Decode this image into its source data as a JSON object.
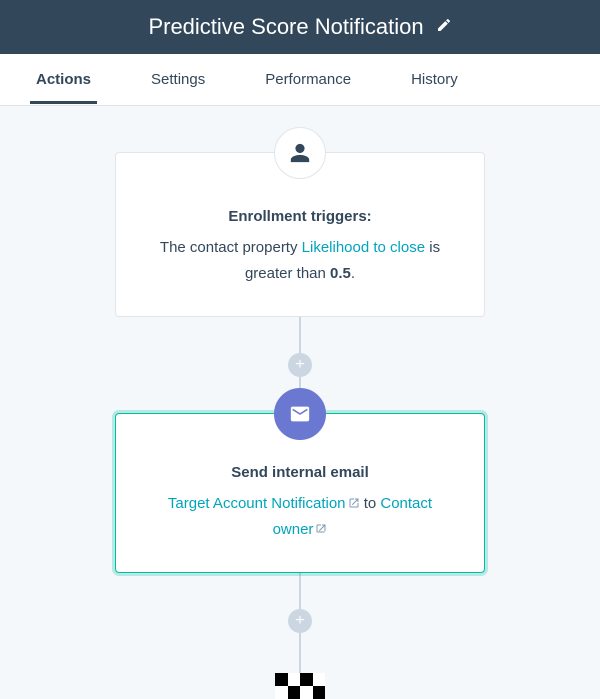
{
  "header": {
    "title": "Predictive Score Notification"
  },
  "tabs": [
    {
      "label": "Actions",
      "active": true
    },
    {
      "label": "Settings",
      "active": false
    },
    {
      "label": "Performance",
      "active": false
    },
    {
      "label": "History",
      "active": false
    }
  ],
  "trigger_card": {
    "title": "Enrollment triggers:",
    "pre_text": "The contact property ",
    "property_link": "Likelihood to close",
    "mid_text": " is greater than ",
    "value": "0.5",
    "post_text": "."
  },
  "action_card": {
    "title": "Send internal email",
    "template_link": "Target Account Notification",
    "middle_text": " to ",
    "recipient_link": "Contact owner"
  },
  "add_label": "+"
}
